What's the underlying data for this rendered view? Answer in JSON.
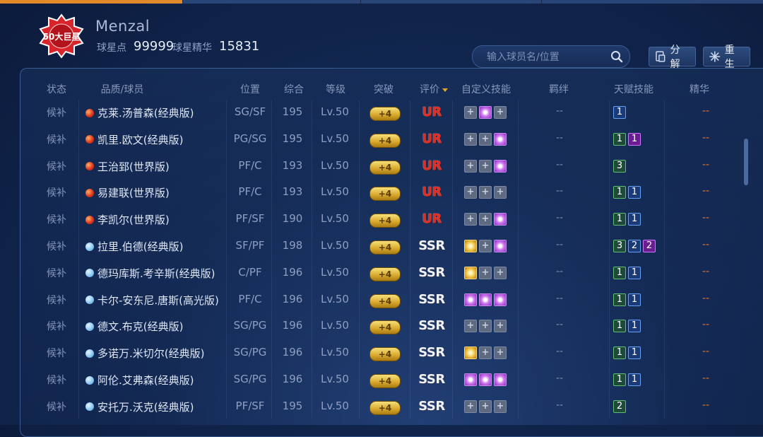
{
  "user": {
    "name": "Menzal",
    "logo_text": "50大巨星"
  },
  "stats": [
    {
      "label": "球星点",
      "value": "99999"
    },
    {
      "label": "球星精华",
      "value": "15831"
    }
  ],
  "search": {
    "placeholder": "输入球员名/位置"
  },
  "buttons": {
    "decompose": "分解",
    "rebirth": "重生"
  },
  "columns": [
    "状态",
    "品质/球员",
    "位置",
    "综合",
    "等级",
    "突破",
    "评价",
    "自定义技能",
    "羁绊",
    "天赋技能",
    "精华"
  ],
  "colors": {
    "accent": "#e28a2a",
    "ur": "#e52a22",
    "essence": "#e4752a"
  },
  "rows": [
    {
      "status": "候补",
      "quality": "red",
      "name": "克莱.汤普森(经典版)",
      "position": "SG/SF",
      "overall": "195",
      "level": "Lv.50",
      "breakthrough": "+4",
      "grade": "UR",
      "skills": [
        "empty",
        "purple",
        "empty"
      ],
      "bond": "--",
      "talents": [
        {
          "v": "1",
          "c": "blue"
        }
      ],
      "essence": "--"
    },
    {
      "status": "候补",
      "quality": "red",
      "name": "凯里.欧文(经典版)",
      "position": "PG/SG",
      "overall": "195",
      "level": "Lv.50",
      "breakthrough": "+4",
      "grade": "UR",
      "skills": [
        "empty",
        "empty",
        "purple"
      ],
      "bond": "--",
      "talents": [
        {
          "v": "1",
          "c": "green"
        },
        {
          "v": "1",
          "c": "purple"
        }
      ],
      "essence": "--"
    },
    {
      "status": "候补",
      "quality": "red",
      "name": "王治郅(世界版)",
      "position": "PF/C",
      "overall": "193",
      "level": "Lv.50",
      "breakthrough": "+4",
      "grade": "UR",
      "skills": [
        "empty",
        "empty",
        "purple"
      ],
      "bond": "--",
      "talents": [
        {
          "v": "3",
          "c": "green"
        }
      ],
      "essence": "--"
    },
    {
      "status": "候补",
      "quality": "red",
      "name": "易建联(世界版)",
      "position": "PF/C",
      "overall": "193",
      "level": "Lv.50",
      "breakthrough": "+4",
      "grade": "UR",
      "skills": [
        "empty",
        "empty",
        "empty"
      ],
      "bond": "--",
      "talents": [
        {
          "v": "1",
          "c": "green"
        },
        {
          "v": "1",
          "c": "blue"
        }
      ],
      "essence": "--"
    },
    {
      "status": "候补",
      "quality": "red",
      "name": "李凯尔(世界版)",
      "position": "PF/SF",
      "overall": "190",
      "level": "Lv.50",
      "breakthrough": "+4",
      "grade": "UR",
      "skills": [
        "empty",
        "empty",
        "purple"
      ],
      "bond": "--",
      "talents": [
        {
          "v": "1",
          "c": "green"
        },
        {
          "v": "1",
          "c": "blue"
        }
      ],
      "essence": "--"
    },
    {
      "status": "候补",
      "quality": "blue",
      "name": "拉里.伯德(经典版)",
      "position": "SF/PF",
      "overall": "198",
      "level": "Lv.50",
      "breakthrough": "+4",
      "grade": "SSR",
      "skills": [
        "gold",
        "empty",
        "purple"
      ],
      "bond": "--",
      "talents": [
        {
          "v": "3",
          "c": "green"
        },
        {
          "v": "2",
          "c": "blue"
        },
        {
          "v": "2",
          "c": "purple"
        }
      ],
      "essence": "--"
    },
    {
      "status": "候补",
      "quality": "blue",
      "name": "德玛库斯.考辛斯(经典版)",
      "position": "C/PF",
      "overall": "196",
      "level": "Lv.50",
      "breakthrough": "+4",
      "grade": "SSR",
      "skills": [
        "gold",
        "empty",
        "empty"
      ],
      "bond": "--",
      "talents": [
        {
          "v": "1",
          "c": "green"
        },
        {
          "v": "1",
          "c": "blue"
        }
      ],
      "essence": "--"
    },
    {
      "status": "候补",
      "quality": "blue",
      "name": "卡尔-安东尼.唐斯(高光版)",
      "position": "PF/C",
      "overall": "196",
      "level": "Lv.50",
      "breakthrough": "+4",
      "grade": "SSR",
      "skills": [
        "purple",
        "purple",
        "purple"
      ],
      "bond": "--",
      "talents": [
        {
          "v": "1",
          "c": "green"
        },
        {
          "v": "1",
          "c": "blue"
        }
      ],
      "essence": "--"
    },
    {
      "status": "候补",
      "quality": "blue",
      "name": "德文.布克(经典版)",
      "position": "SG/PG",
      "overall": "196",
      "level": "Lv.50",
      "breakthrough": "+4",
      "grade": "SSR",
      "skills": [
        "empty",
        "empty",
        "empty"
      ],
      "bond": "--",
      "talents": [
        {
          "v": "1",
          "c": "green"
        },
        {
          "v": "1",
          "c": "blue"
        }
      ],
      "essence": "--"
    },
    {
      "status": "候补",
      "quality": "blue",
      "name": "多诺万.米切尔(经典版)",
      "position": "SG/PG",
      "overall": "196",
      "level": "Lv.50",
      "breakthrough": "+4",
      "grade": "SSR",
      "skills": [
        "gold",
        "empty",
        "empty"
      ],
      "bond": "--",
      "talents": [
        {
          "v": "1",
          "c": "green"
        },
        {
          "v": "1",
          "c": "blue"
        }
      ],
      "essence": "--"
    },
    {
      "status": "候补",
      "quality": "blue",
      "name": "阿伦.艾弗森(经典版)",
      "position": "SG/PG",
      "overall": "196",
      "level": "Lv.50",
      "breakthrough": "+4",
      "grade": "SSR",
      "skills": [
        "purple",
        "purple",
        "purple"
      ],
      "bond": "--",
      "talents": [
        {
          "v": "1",
          "c": "green"
        },
        {
          "v": "1",
          "c": "blue"
        }
      ],
      "essence": "--"
    },
    {
      "status": "候补",
      "quality": "blue",
      "name": "安托万.沃克(经典版)",
      "position": "PF/SF",
      "overall": "195",
      "level": "Lv.50",
      "breakthrough": "+4",
      "grade": "SSR",
      "skills": [
        "empty",
        "empty",
        "empty"
      ],
      "bond": "--",
      "talents": [
        {
          "v": "2",
          "c": "green"
        }
      ],
      "essence": "--"
    }
  ]
}
